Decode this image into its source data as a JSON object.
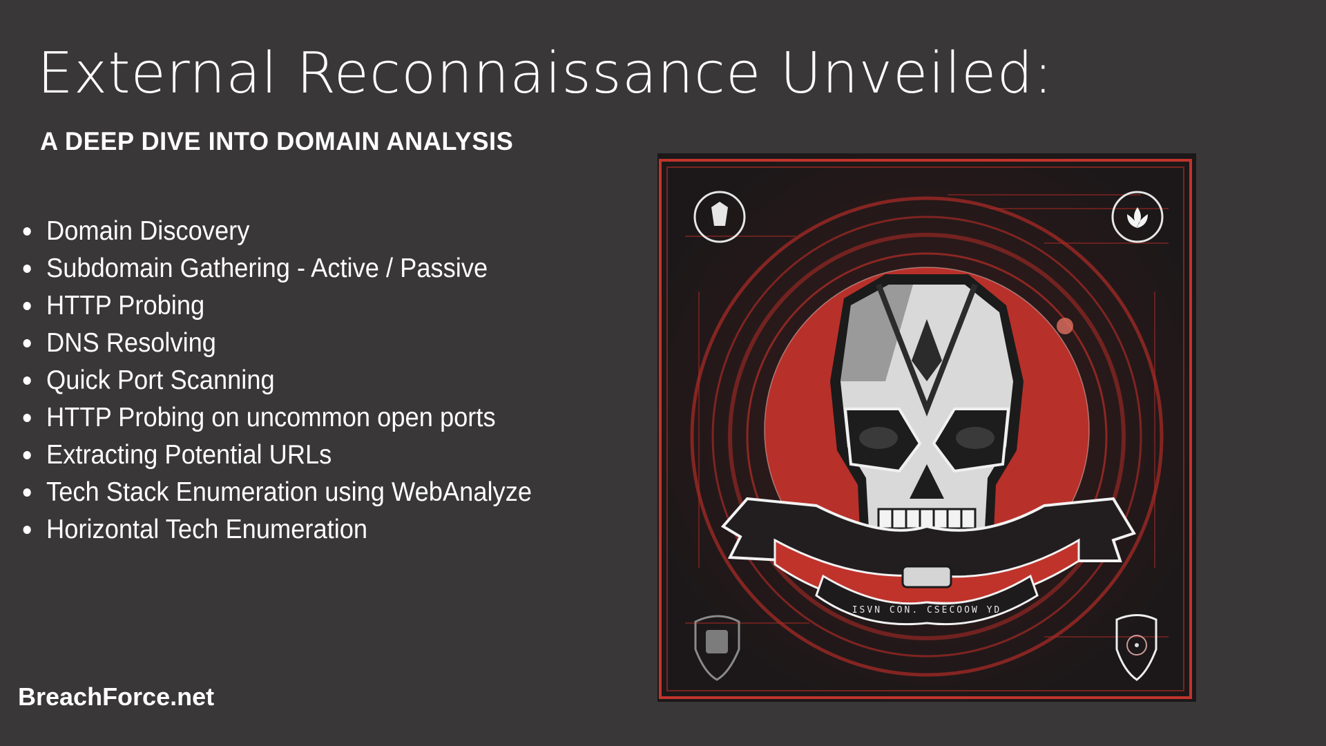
{
  "slide": {
    "title": "External Reconnaissance Unveiled:",
    "subtitle": "A DEEP DIVE INTO DOMAIN ANALYSIS",
    "bullets": [
      "Domain Discovery",
      "Subdomain Gathering - Active / Passive",
      "HTTP Probing",
      "DNS Resolving",
      "Quick Port Scanning",
      "HTTP Probing on uncommon open ports",
      "Extracting Potential URLs",
      "Tech Stack Enumeration using WebAnalyze",
      "Horizontal Tech Enumeration"
    ],
    "footer": "BreachForce.net"
  },
  "artwork": {
    "description": "Red and black skull emblem with banner and four corner badges",
    "banner_text": "ISVN CON. CSECOOW YD",
    "icons": [
      "skull-emblem-icon",
      "demon-badge-icon",
      "lotus-badge-icon",
      "shield-vest-badge-icon",
      "shield-gear-badge-icon"
    ]
  },
  "colors": {
    "background": "#393738",
    "text": "#ffffff",
    "art_red": "#b8302a",
    "art_dark": "#221e1f"
  }
}
